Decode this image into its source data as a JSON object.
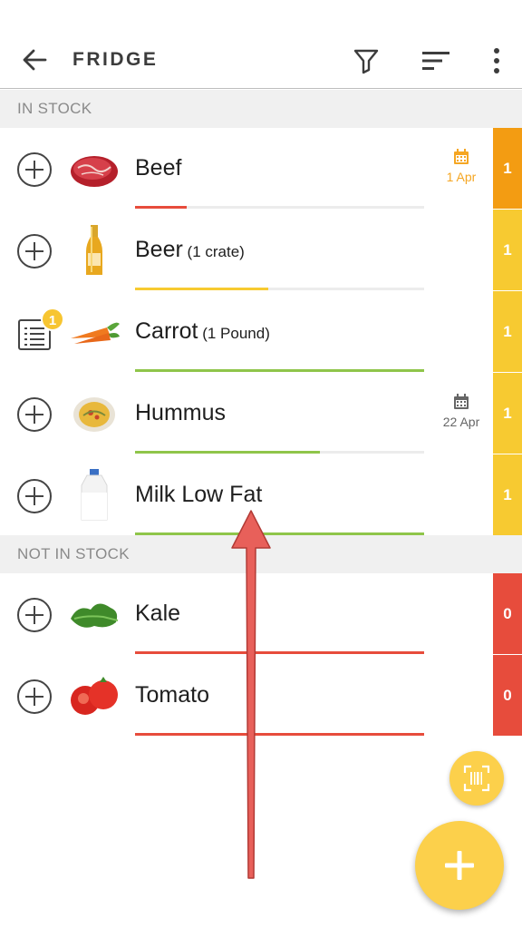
{
  "appbar": {
    "title": "FRIDGE",
    "icons": [
      "back-arrow-icon",
      "filter-icon",
      "sort-icon",
      "more-vert-icon"
    ]
  },
  "sections": [
    {
      "header": "IN STOCK",
      "items": [
        {
          "name": "Beef",
          "qty": "",
          "image": "beef",
          "count": "1",
          "level": 0.18,
          "bar_color": "#e74c3c",
          "count_color": "#f39c12",
          "date": "1 Apr",
          "date_color": "#f5a623",
          "action": "plus",
          "badge": ""
        },
        {
          "name": "Beer",
          "qty": " (1 crate)",
          "image": "beer",
          "count": "1",
          "level": 0.46,
          "bar_color": "#f7ca31",
          "count_color": "#f7ca31",
          "date": "",
          "date_color": "",
          "action": "plus",
          "badge": ""
        },
        {
          "name": "Carrot",
          "qty": " (1 Pound)",
          "image": "carrot",
          "count": "1",
          "level": 1.0,
          "bar_color": "#8fc54a",
          "count_color": "#f7ca31",
          "date": "",
          "date_color": "",
          "action": "list",
          "badge": "1"
        },
        {
          "name": "Hummus",
          "qty": "",
          "image": "hummus",
          "count": "1",
          "level": 0.64,
          "bar_color": "#8fc54a",
          "count_color": "#f7ca31",
          "date": "22 Apr",
          "date_color": "#666666",
          "action": "plus",
          "badge": ""
        },
        {
          "name": "Milk Low Fat",
          "qty": "",
          "image": "milk",
          "count": "1",
          "level": 1.0,
          "bar_color": "#8fc54a",
          "count_color": "#f7ca31",
          "date": "",
          "date_color": "",
          "action": "plus",
          "badge": ""
        }
      ]
    },
    {
      "header": "NOT IN STOCK",
      "items": [
        {
          "name": "Kale",
          "qty": "",
          "image": "kale",
          "count": "0",
          "level": 1.0,
          "bar_color": "#e74c3c",
          "count_color": "#e74c3c",
          "date": "",
          "date_color": "",
          "action": "plus",
          "badge": ""
        },
        {
          "name": "Tomato",
          "qty": "",
          "image": "tomato",
          "count": "0",
          "level": 1.0,
          "bar_color": "#e74c3c",
          "count_color": "#e74c3c",
          "date": "",
          "date_color": "",
          "action": "plus",
          "badge": ""
        }
      ]
    }
  ],
  "fabs": {
    "scan_icon": "barcode-scan-icon",
    "add_icon": "plus-icon"
  },
  "colors": {
    "accent": "#fcd04b",
    "annotation_arrow": "#e8605a"
  }
}
